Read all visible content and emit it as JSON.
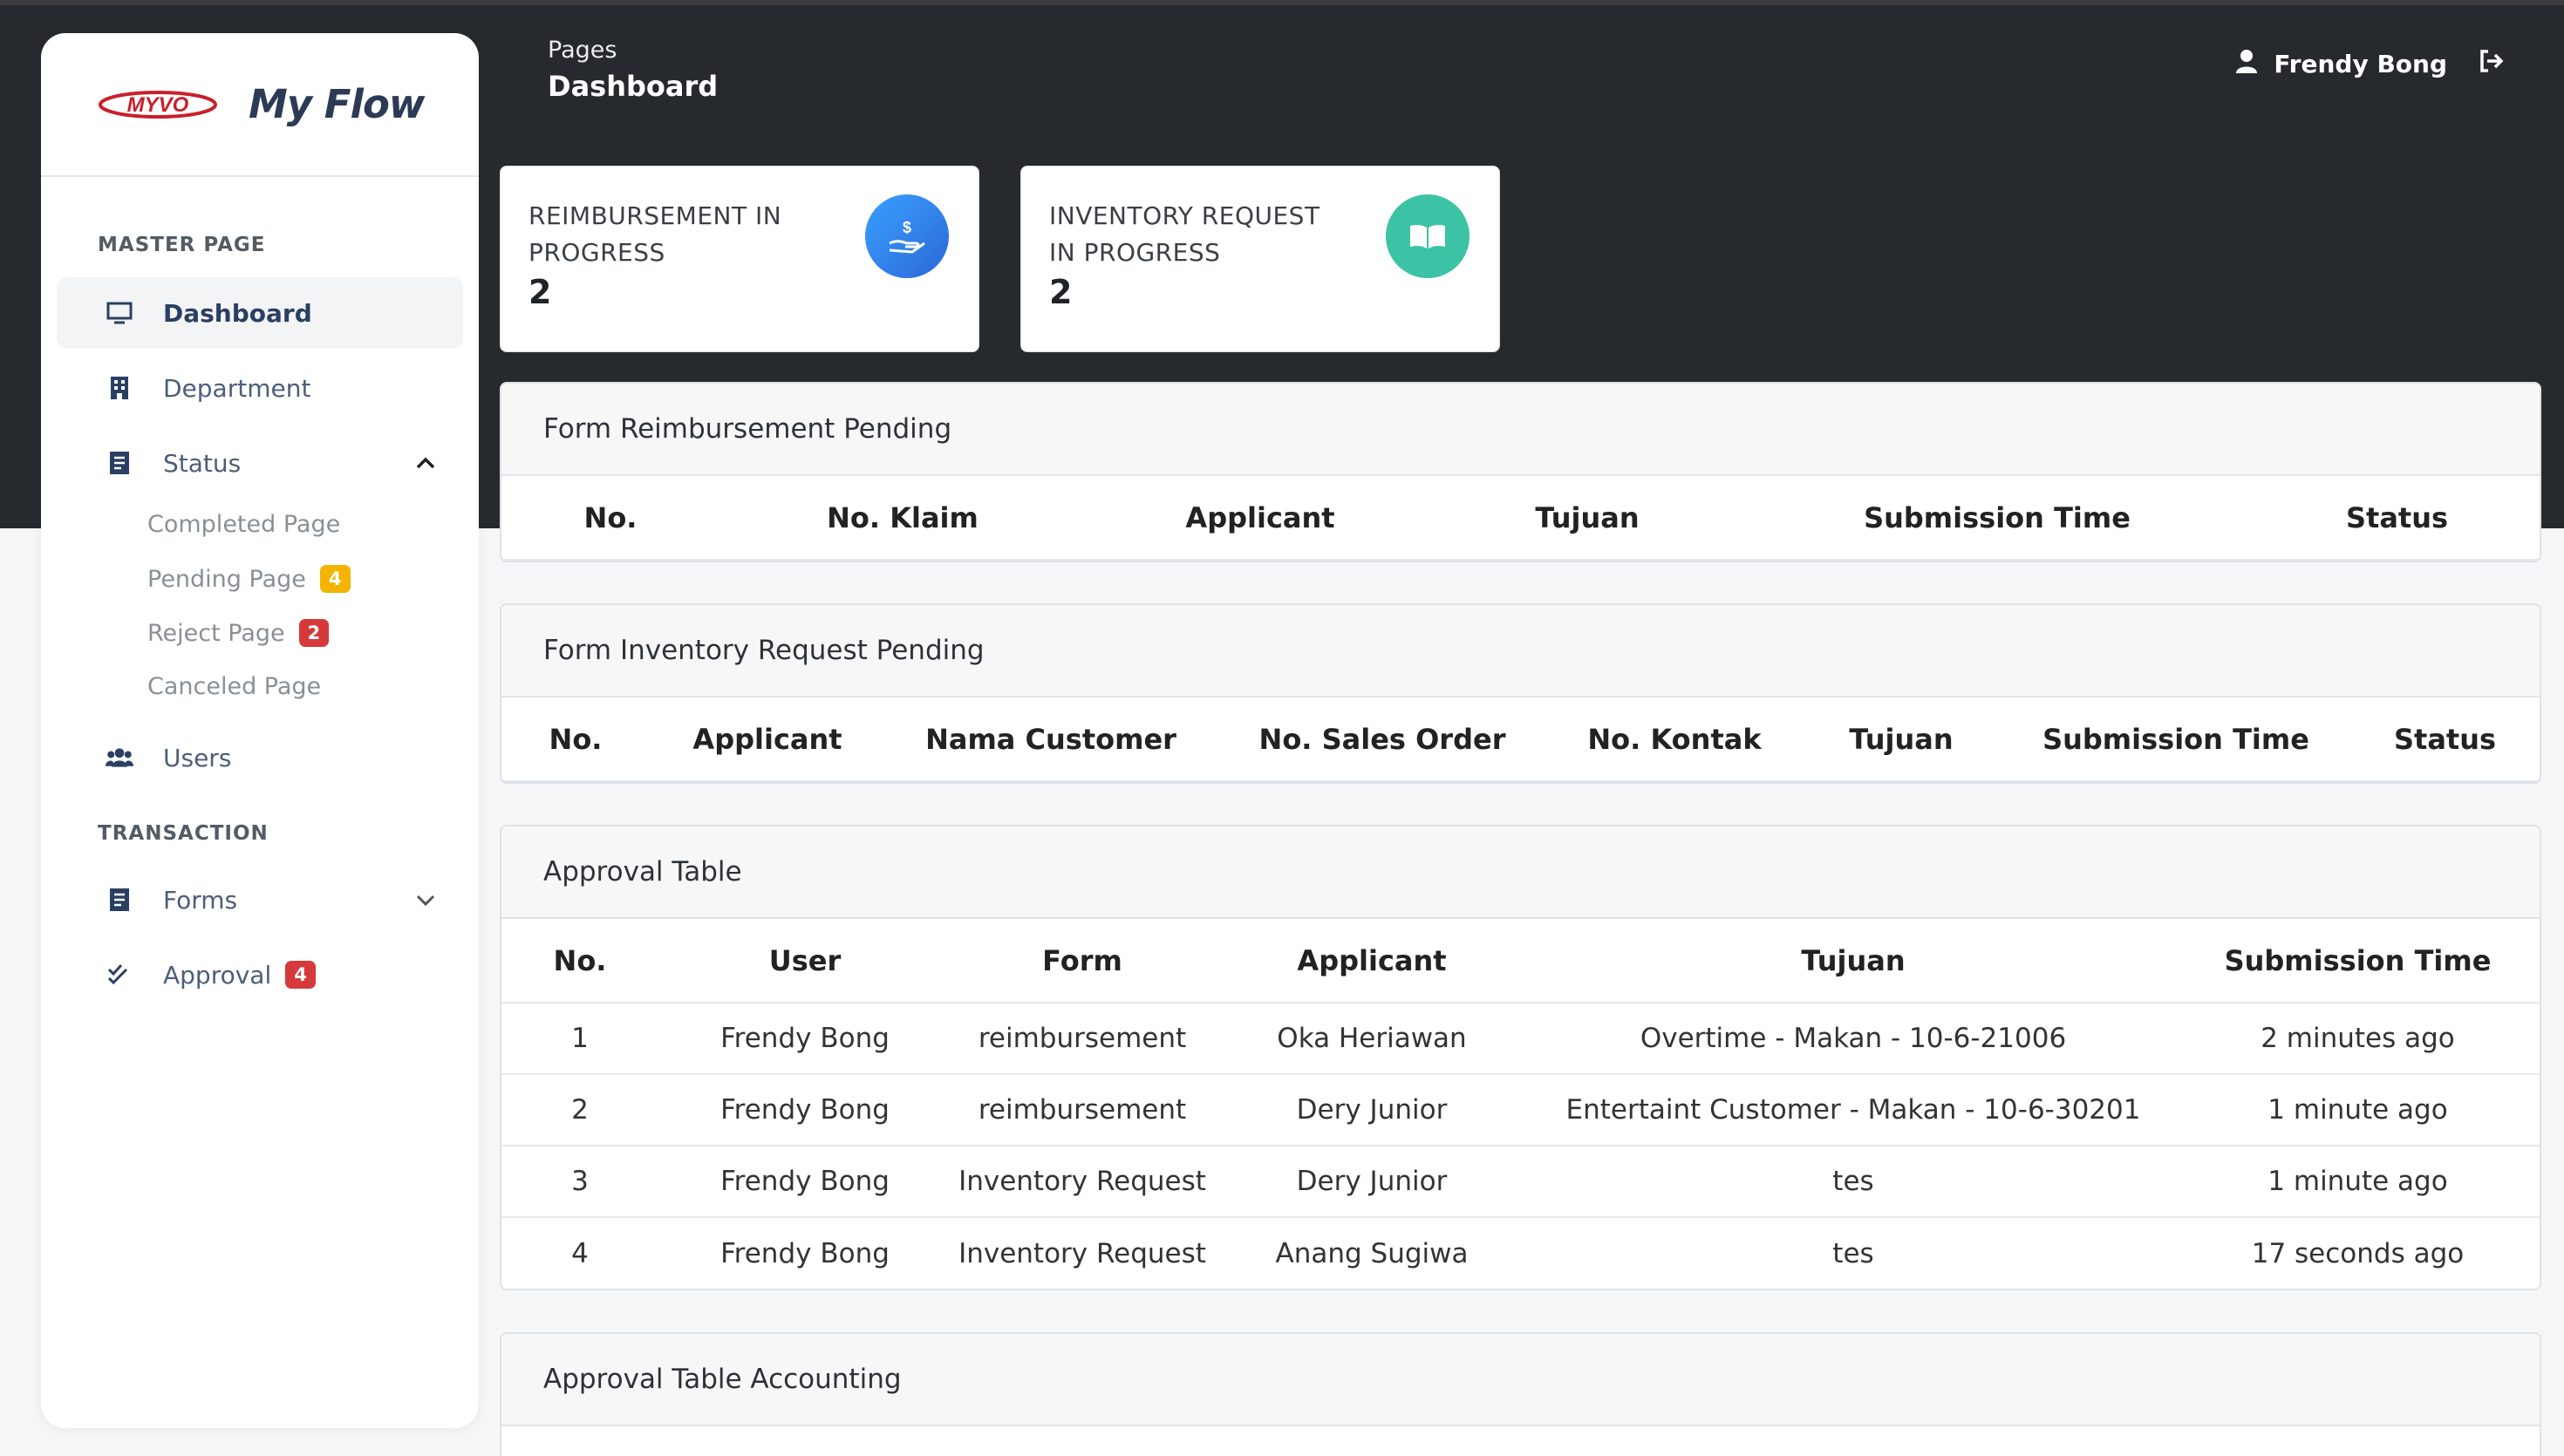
{
  "header": {
    "crumb_small": "Pages",
    "crumb_title": "Dashboard",
    "user_name": "Frendy Bong"
  },
  "brand": {
    "logo_text": "MYVO",
    "title": "My Flow"
  },
  "sidebar": {
    "section_master": "MASTER PAGE",
    "section_transaction": "TRANSACTION",
    "items": {
      "dashboard": "Dashboard",
      "department": "Department",
      "status": "Status",
      "users": "Users",
      "forms": "Forms",
      "approval": "Approval"
    },
    "approval_badge": "4",
    "sub_items": {
      "completed": "Completed Page",
      "pending": "Pending Page",
      "reject": "Reject Page",
      "canceled": "Canceled Page"
    },
    "pending_badge": "4",
    "reject_badge": "2"
  },
  "stats": [
    {
      "label": "REIMBURSEMENT IN PROGRESS",
      "value": "2",
      "icon": "hand-dollar-icon",
      "color": "#3b82f6"
    },
    {
      "label": "INVENTORY REQUEST IN PROGRESS",
      "value": "2",
      "icon": "book-icon",
      "color": "#3cc3a5"
    }
  ],
  "reimbursement_pending": {
    "title": "Form Reimbursement Pending",
    "columns": [
      "No.",
      "No. Klaim",
      "Applicant",
      "Tujuan",
      "Submission Time",
      "Status"
    ]
  },
  "inventory_pending": {
    "title": "Form Inventory Request Pending",
    "columns": [
      "No.",
      "Applicant",
      "Nama Customer",
      "No. Sales Order",
      "No. Kontak",
      "Tujuan",
      "Submission Time",
      "Status"
    ]
  },
  "approval_table": {
    "title": "Approval Table",
    "columns": [
      "No.",
      "User",
      "Form",
      "Applicant",
      "Tujuan",
      "Submission Time"
    ],
    "rows": [
      [
        "1",
        "Frendy Bong",
        "reimbursement",
        "Oka Heriawan",
        "Overtime - Makan - 10-6-21006",
        "2 minutes ago"
      ],
      [
        "2",
        "Frendy Bong",
        "reimbursement",
        "Dery Junior",
        "Entertaint Customer - Makan - 10-6-30201",
        "1 minute ago"
      ],
      [
        "3",
        "Frendy Bong",
        "Inventory Request",
        "Dery Junior",
        "tes",
        "1 minute ago"
      ],
      [
        "4",
        "Frendy Bong",
        "Inventory Request",
        "Anang Sugiwa",
        "tes",
        "17 seconds ago"
      ]
    ]
  },
  "approval_accounting": {
    "title": "Approval Table Accounting"
  }
}
